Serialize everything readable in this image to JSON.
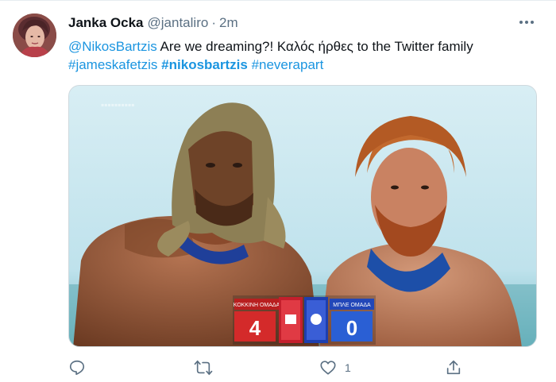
{
  "tweet": {
    "author": {
      "display_name": "Janka Ocka",
      "handle": "@jantaliro",
      "separator": "·",
      "time": "2m"
    },
    "text": {
      "mention": "@NikosBartzis",
      "body": " Are we dreaming?! Καλός ήρθες to the Twitter family",
      "hashtag_1": "#jameskafetzis",
      "hashtag_2": "#nikosbartzis",
      "hashtag_3": "#neverapart"
    },
    "media": {
      "score_left_label": "ΚΟΚΚΙΝΗ ΟΜΑΔΑ",
      "score_right_label": "ΜΠΛΕ ΟΜΑΔΑ",
      "score_left": "4",
      "score_right": "0"
    },
    "actions": {
      "reply_count": "",
      "retweet_count": "",
      "like_count": "1"
    },
    "colors": {
      "link": "#1b95e0",
      "secondary_text": "#5b7083",
      "score_red": "#d42a2a",
      "score_blue": "#2a5fd4"
    },
    "icons": [
      "more-icon",
      "reply-icon",
      "retweet-icon",
      "like-icon",
      "share-icon"
    ]
  }
}
